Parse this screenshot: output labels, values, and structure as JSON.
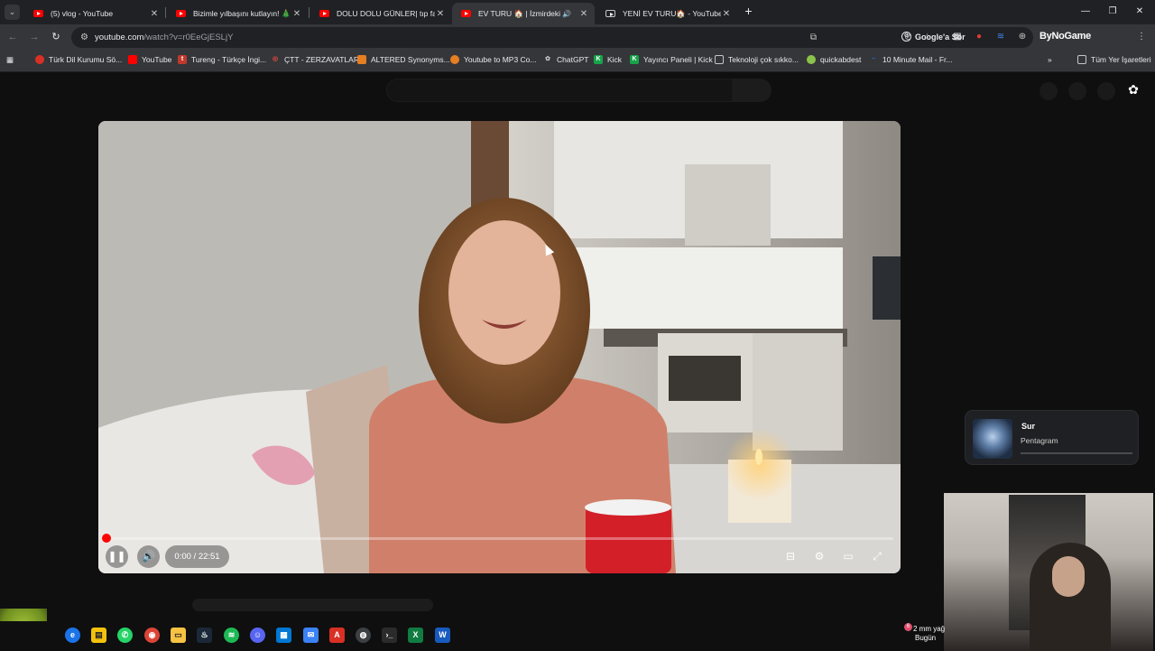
{
  "tabs": [
    {
      "title": "(5) vlog - YouTube",
      "active": false
    },
    {
      "title": "Bizimle yılbaşını kutlayın! 🎄 | V",
      "active": false
    },
    {
      "title": "DOLU DOLU GÜNLER| tıp fakült",
      "active": false
    },
    {
      "title": "EV TURU 🏠 | İzmirdeki 1+",
      "active": true
    },
    {
      "title": "YENİ EV TURU🏠 - YouTube",
      "active": false
    }
  ],
  "address": {
    "host": "youtube.com",
    "path": "/watch?v=r0EeGjESLjY"
  },
  "toolbar": {
    "google_sor": "Google'a Sor",
    "extension_label": "ByNoGame"
  },
  "bookmarks": [
    {
      "label": "Türk Dil Kurumu Sö...",
      "color": "#d93025",
      "glyph": ""
    },
    {
      "label": "YouTube",
      "color": "#ff0000",
      "glyph": ""
    },
    {
      "label": "Tureng - Türkçe İngi...",
      "color": "#c0392b",
      "glyph": "t"
    },
    {
      "label": "ÇTT - ZERZAVATLAR",
      "color": "#e74c3c",
      "glyph": ""
    },
    {
      "label": "ALTERED Synonyms...",
      "color": "#e67e22",
      "glyph": ""
    },
    {
      "label": "Youtube to MP3 Co...",
      "color": "#e67e22",
      "glyph": ""
    },
    {
      "label": "ChatGPT",
      "color": "#5f6368",
      "glyph": ""
    },
    {
      "label": "Kick",
      "color": "#16a34a",
      "glyph": "K"
    },
    {
      "label": "Yayıncı Paneli | Kick",
      "color": "#16a34a",
      "glyph": "K"
    },
    {
      "label": "Teknoloji çok sıkko...",
      "color": "#5f6368",
      "glyph": ""
    },
    {
      "label": "quickabdest",
      "color": "#8bc34a",
      "glyph": ""
    },
    {
      "label": "10 Minute Mail - Fr...",
      "color": "#1a73e8",
      "glyph": ""
    }
  ],
  "bookmarks_all": "Tüm Yer İşaretleri",
  "player": {
    "time": "0:00 / 22:51",
    "progress": 0.0
  },
  "now_playing": {
    "title": "Sur",
    "artist": "Pentagram",
    "progress": 0.0
  },
  "taskbar": {
    "notification_count": "6",
    "status": "2 mm yağ",
    "day": "Bugün"
  }
}
